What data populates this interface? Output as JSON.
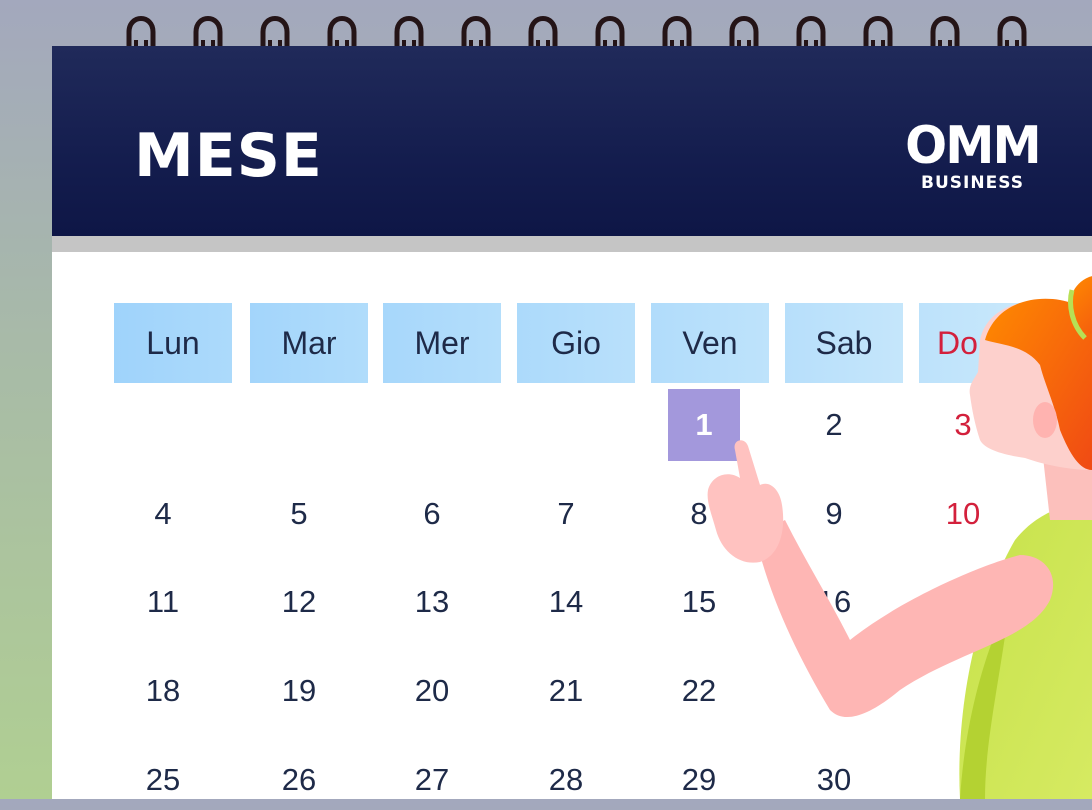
{
  "calendar": {
    "month_title": "MESE",
    "logo": {
      "main": "OMM",
      "sub": "BUSINESS"
    },
    "weekdays": [
      "Lun",
      "Mar",
      "Mer",
      "Gio",
      "Ven",
      "Sab",
      "Do"
    ],
    "weeks": [
      [
        "",
        "",
        "",
        "",
        "1",
        "2",
        "3"
      ],
      [
        "4",
        "5",
        "6",
        "7",
        "8",
        "9",
        "10"
      ],
      [
        "11",
        "12",
        "13",
        "14",
        "15",
        "16",
        ""
      ],
      [
        "18",
        "19",
        "20",
        "21",
        "22",
        "",
        ""
      ],
      [
        "25",
        "26",
        "27",
        "28",
        "29",
        "30",
        ""
      ]
    ],
    "selected_date": "1",
    "colors": {
      "header_bg": "#141d4e",
      "weekday_bg": "#a9d8fb",
      "selected_bg": "#a398dc",
      "sunday_text": "#d3203c",
      "date_text": "#1e2a48"
    }
  }
}
